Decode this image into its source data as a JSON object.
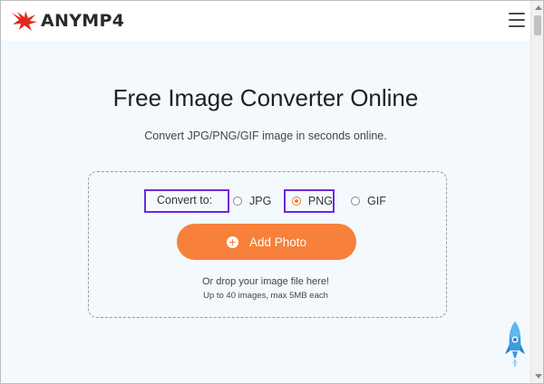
{
  "header": {
    "brand": "ANYMP4",
    "logo_icon": "anymp4-bird-logo",
    "menu_icon": "hamburger-menu-icon",
    "brand_color": "#e02a20"
  },
  "main": {
    "title": "Free Image Converter Online",
    "subtitle": "Convert JPG/PNG/GIF image in seconds online.",
    "convert_label": "Convert to:",
    "formats": [
      {
        "label": "JPG",
        "selected": false
      },
      {
        "label": "PNG",
        "selected": true
      },
      {
        "label": "GIF",
        "selected": false
      }
    ],
    "add_photo_label": "Add Photo",
    "drop_text": "Or drop your image file here!",
    "limit_text": "Up to 40 images, max 5MB each",
    "accent_color": "#f7803b",
    "highlight_color": "#6b2bd8"
  },
  "floating": {
    "rocket_icon": "rocket-icon"
  }
}
